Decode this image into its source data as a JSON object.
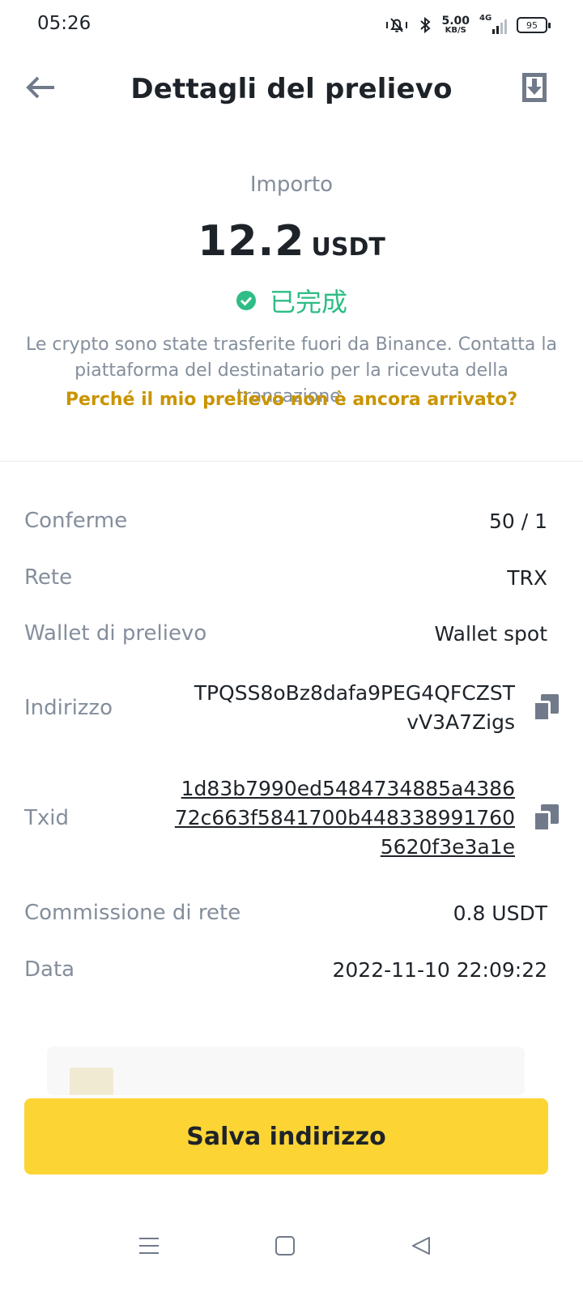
{
  "status_bar": {
    "time": "05:26",
    "net_speed_value": "5.00",
    "net_speed_unit": "KB/S",
    "network_type": "4G",
    "battery_level": "95",
    "icons": [
      "mute-vibrate-icon",
      "bluetooth-icon",
      "signal-icon",
      "battery-icon"
    ]
  },
  "header": {
    "title": "Dettagli del prelievo",
    "back_icon": "arrow-left-icon",
    "share_icon": "download-share-icon"
  },
  "amount": {
    "label": "Importo",
    "value": "12.2",
    "unit": "USDT",
    "status": "已完成",
    "status_color": "#2ebd85",
    "info": "Le crypto sono state trasferite fuori da Binance. Contatta la piattaforma del destinatario per la ricevuta della transazione.",
    "help_link": "Perché il mio prelievo non è ancora arrivato?",
    "help_link_color": "#c99400"
  },
  "details": {
    "confirmations": {
      "label": "Conferme",
      "value": "50 / 1"
    },
    "network": {
      "label": "Rete",
      "value": "TRX"
    },
    "wallet": {
      "label": "Wallet di prelievo",
      "value": "Wallet spot"
    },
    "address": {
      "label": "Indirizzo",
      "lines": [
        "TPQSS8oBz8dafa9PEG4QFCZST",
        "vV3A7Zigs"
      ]
    },
    "txid": {
      "label": "Txid",
      "lines": [
        "1d83b7990ed5484734885a4386",
        "72c663f5841700b448338991760",
        "5620f3e3a1e"
      ]
    },
    "fee": {
      "label": "Commissione di rete",
      "value": "0.8 USDT"
    },
    "date": {
      "label": "Data",
      "value": "2022-11-10 22:09:22"
    }
  },
  "actions": {
    "save_label": "Salva indirizzo",
    "save_color": "#fcd535"
  },
  "nav_bar": {
    "icons": [
      "menu-icon",
      "home-square-icon",
      "back-triangle-icon"
    ]
  }
}
